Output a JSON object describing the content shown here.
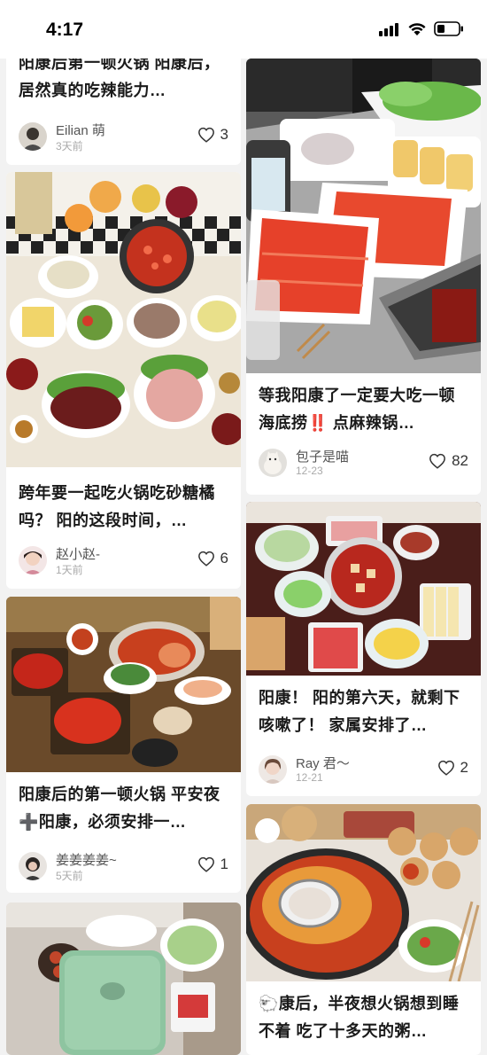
{
  "status": {
    "time": "4:17"
  },
  "left_cards": [
    {
      "title": "阳康后第一顿火锅 阳康后，居然真的吃辣能力…",
      "author": "Eilian 萌",
      "date": "3天前",
      "likes": "3"
    },
    {
      "title": "跨年要一起吃火锅吃砂糖橘吗？ 阳的这段时间，…",
      "author": "赵小赵-",
      "date": "1天前",
      "likes": "6"
    },
    {
      "title": "阳康后的第一顿火锅 平安夜➕阳康，必须安排一…",
      "author": "姜姜姜姜~",
      "date": "5天前",
      "likes": "1"
    },
    {
      "title": "",
      "author": "",
      "date": "",
      "likes": ""
    }
  ],
  "right_cards": [
    {
      "title": "等我阳康了一定要大吃一顿海底捞‼️ 点麻辣锅…",
      "author": "包子是喵",
      "date": "12-23",
      "likes": "82"
    },
    {
      "title": "阳康！ 阳的第六天，就剩下咳嗽了！ 家属安排了…",
      "author": "Ray 君～",
      "date": "12-21",
      "likes": "2"
    },
    {
      "title": "🐑康后，半夜想火锅想到睡不着 吃了十多天的粥…",
      "author": "",
      "date": "",
      "likes": ""
    }
  ],
  "colors": {
    "background": "#f2f2f2",
    "card": "#ffffff",
    "title": "#1a1a1a",
    "meta": "#aaaaaa"
  },
  "icons": [
    "signal-icon",
    "wifi-icon",
    "battery-icon",
    "heart-icon"
  ]
}
